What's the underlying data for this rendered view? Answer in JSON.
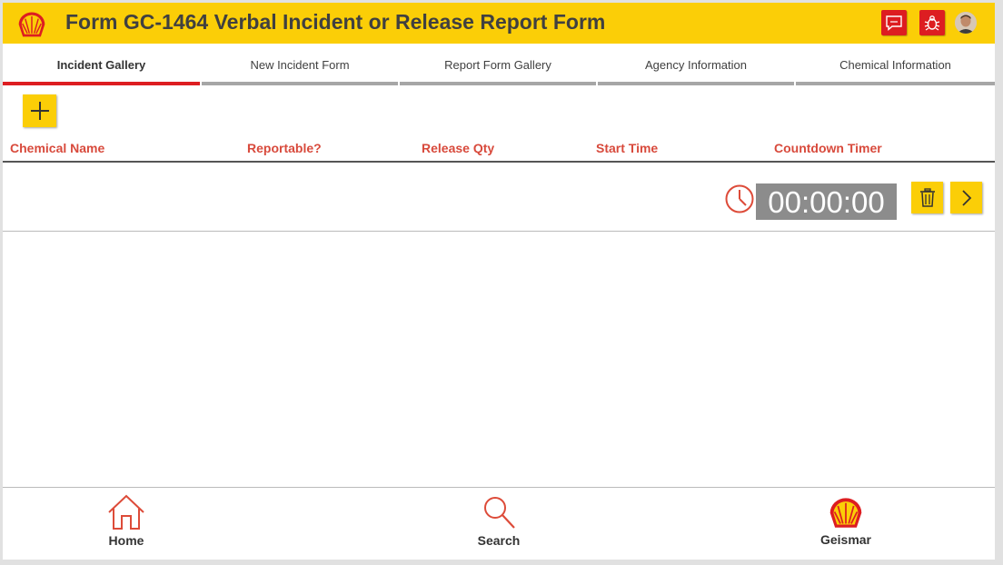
{
  "app": {
    "title": "Form GC-1464 Verbal Incident or Release Report Form",
    "accent_yellow": "#fbce07",
    "accent_red": "#dd1d21",
    "header_icons": [
      "chat-icon",
      "bug-icon",
      "user-avatar"
    ]
  },
  "tabs": [
    {
      "label": "Incident Gallery",
      "active": true
    },
    {
      "label": "New Incident Form",
      "active": false
    },
    {
      "label": "Report Form Gallery",
      "active": false
    },
    {
      "label": "Agency Information",
      "active": false
    },
    {
      "label": "Chemical Information",
      "active": false
    }
  ],
  "table": {
    "columns": [
      "Chemical Name",
      "Reportable?",
      "Release Qty",
      "Start Time",
      "Countdown Timer"
    ],
    "rows": [
      {
        "chemical_name": "",
        "reportable": "",
        "release_qty": "",
        "start_time": "",
        "countdown": "00:00:00"
      }
    ]
  },
  "footer": {
    "home_label": "Home",
    "search_label": "Search",
    "site_label": "Geismar"
  }
}
